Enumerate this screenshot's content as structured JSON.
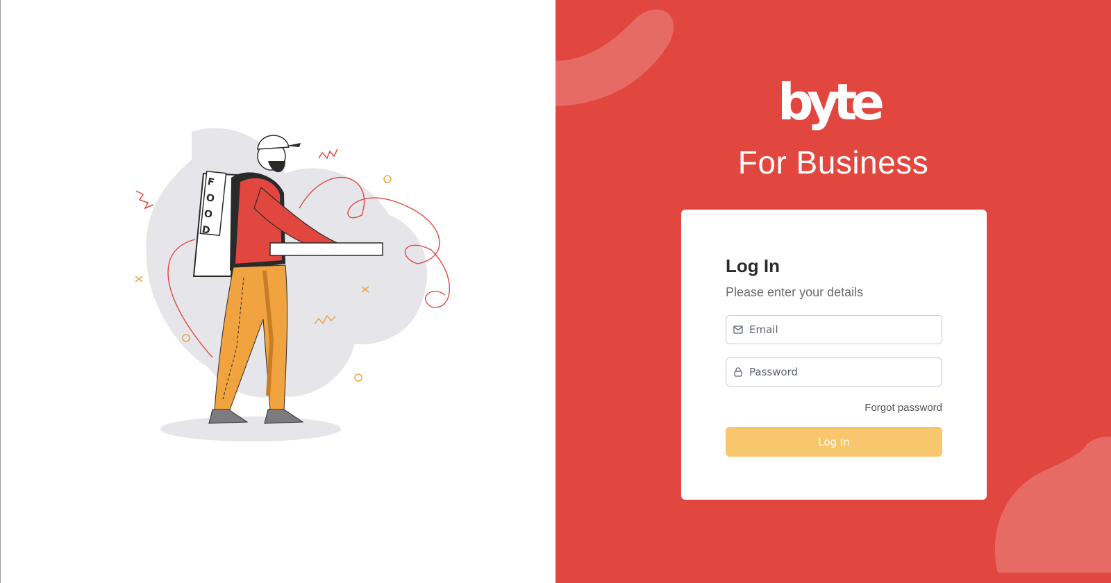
{
  "brand": {
    "logo_text": "byte",
    "tagline": "For Business"
  },
  "illustration": {
    "bag_letters": [
      "F",
      "O",
      "O",
      "D"
    ]
  },
  "login_card": {
    "title": "Log In",
    "subtitle": "Please enter your details",
    "email": {
      "placeholder": "Email",
      "icon": "mail-icon"
    },
    "password": {
      "placeholder": "Password",
      "icon": "lock-icon"
    },
    "forgot_label": "Forgot password",
    "submit_label": "Log In"
  },
  "colors": {
    "brand_red": "#e2473f",
    "button_yellow": "#f8c66d",
    "pants_orange": "#f0a33e",
    "text_dark": "#2a2a2a"
  }
}
